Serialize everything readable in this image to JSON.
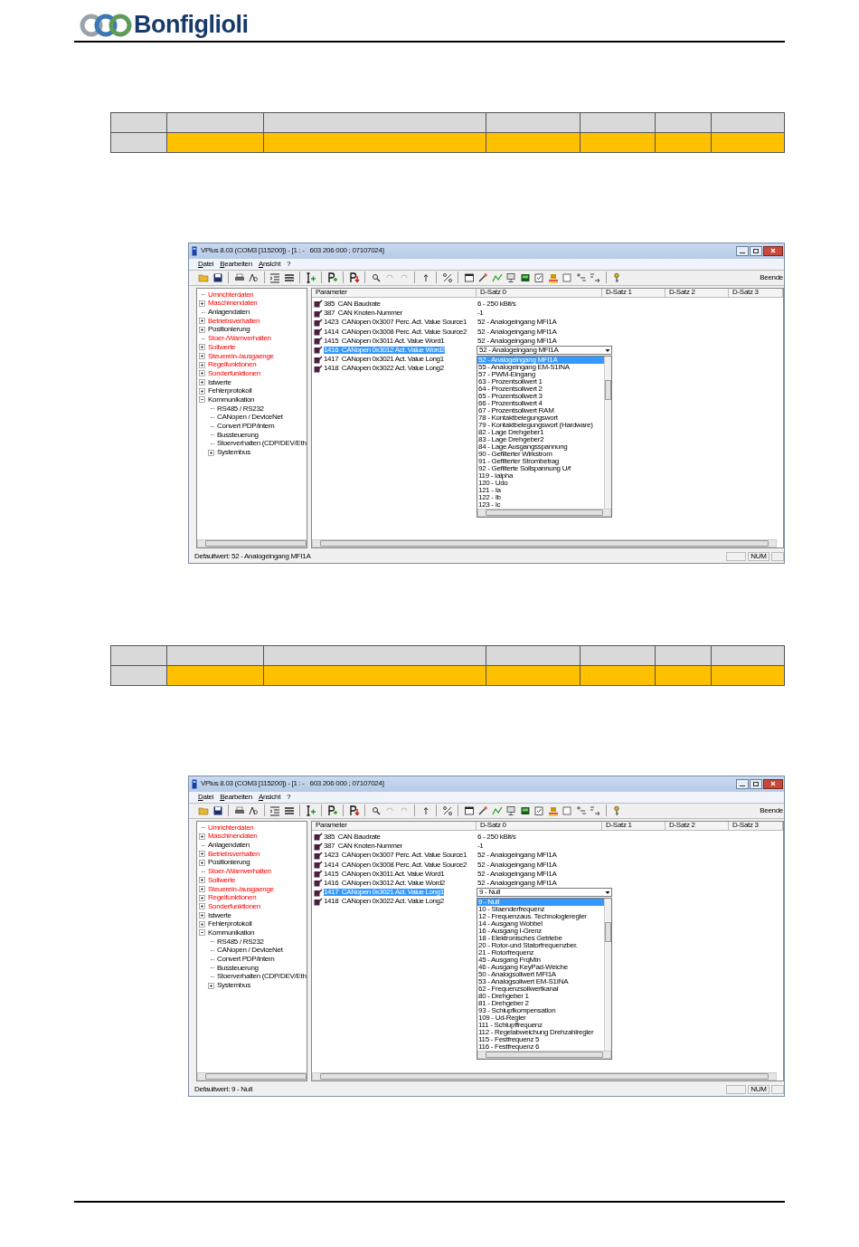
{
  "brand": "Bonfiglioli",
  "tables": [
    {
      "rows": [
        [
          {
            "color": "#d9d9d9"
          },
          {
            "color": "#d9d9d9"
          },
          {
            "color": "#d9d9d9"
          },
          {
            "color": "#d9d9d9"
          },
          {
            "color": "#d9d9d9"
          },
          {
            "color": "#d9d9d9"
          },
          {
            "color": "#d9d9d9"
          }
        ],
        [
          {
            "color": "#d9d9d9"
          },
          {
            "color": "#ffc000"
          },
          {
            "color": "#ffc000"
          },
          {
            "color": "#ffc000"
          },
          {
            "color": "#ffc000"
          },
          {
            "color": "#ffc000"
          },
          {
            "color": "#ffc000"
          }
        ]
      ]
    },
    {
      "rows": [
        [
          {
            "color": "#d9d9d9"
          },
          {
            "color": "#d9d9d9"
          },
          {
            "color": "#d9d9d9"
          },
          {
            "color": "#d9d9d9"
          },
          {
            "color": "#d9d9d9"
          },
          {
            "color": "#d9d9d9"
          },
          {
            "color": "#d9d9d9"
          }
        ],
        [
          {
            "color": "#d9d9d9"
          },
          {
            "color": "#ffc000"
          },
          {
            "color": "#ffc000"
          },
          {
            "color": "#ffc000"
          },
          {
            "color": "#ffc000"
          },
          {
            "color": "#ffc000"
          },
          {
            "color": "#ffc000"
          }
        ]
      ]
    }
  ],
  "screens": [
    {
      "title": "VPlus 8.03 (COM3 [115200]) - [1 : -   603 206 000 ; 07107024]",
      "menu": [
        "Datei",
        "Bearbeiten",
        "Ansicht",
        "?"
      ],
      "toolbar_label": "Beende",
      "tree": [
        {
          "label": "Umrichterdaten",
          "emphasized": true,
          "kind": "leaf"
        },
        {
          "label": "Maschinendaten",
          "emphasized": true,
          "kind": "branch",
          "expanded": false
        },
        {
          "label": "Anlagendaten",
          "emphasized": false,
          "kind": "leaf"
        },
        {
          "label": "Betriebsverhalten",
          "emphasized": true,
          "kind": "branch",
          "expanded": false
        },
        {
          "label": "Positionierung",
          "emphasized": false,
          "kind": "branch",
          "expanded": false
        },
        {
          "label": "Stoer-/Warnverhalten",
          "emphasized": true,
          "kind": "leaf"
        },
        {
          "label": "Sollwerte",
          "emphasized": true,
          "kind": "branch",
          "expanded": false
        },
        {
          "label": "Steuerein-/ausgaenge",
          "emphasized": true,
          "kind": "branch",
          "expanded": false
        },
        {
          "label": "Regelfunktionen",
          "emphasized": true,
          "kind": "branch",
          "expanded": false
        },
        {
          "label": "Sonderfunktionen",
          "emphasized": true,
          "kind": "branch",
          "expanded": false
        },
        {
          "label": "Istwerte",
          "emphasized": false,
          "kind": "branch",
          "expanded": false
        },
        {
          "label": "Fehlerprotokoll",
          "emphasized": false,
          "kind": "branch",
          "expanded": false
        },
        {
          "label": "Kommunikation",
          "emphasized": false,
          "kind": "branch",
          "expanded": true,
          "children": [
            {
              "label": "RS485 / RS232",
              "emphasized": false,
              "kind": "leaf"
            },
            {
              "label": "CANopen / DeviceNet",
              "emphasized": false,
              "kind": "leaf"
            },
            {
              "label": "Convert PDP/intern",
              "emphasized": false,
              "kind": "leaf"
            },
            {
              "label": "Bussteuerung",
              "emphasized": false,
              "kind": "leaf"
            },
            {
              "label": "Stoerverhalten (CDP/DEV/Eth",
              "emphasized": false,
              "kind": "leaf"
            },
            {
              "label": "Systembus",
              "emphasized": false,
              "kind": "branch",
              "expanded": false
            }
          ]
        }
      ],
      "columns": [
        "Parameter",
        "D-Satz 0",
        "D-Satz 1",
        "D-Satz 2",
        "D-Satz 3"
      ],
      "rows": [
        {
          "number": "385",
          "name": "CAN Baudrate",
          "value": "6 - 250 kBit/s",
          "selected": false
        },
        {
          "number": "387",
          "name": "CAN Knoten-Nummer",
          "value": "-1",
          "selected": false
        },
        {
          "number": "1423",
          "name": "CANopen 0x3007 Perc. Act. Value Source1",
          "value": "52 - Analogeingang MFI1A",
          "selected": false
        },
        {
          "number": "1414",
          "name": "CANopen 0x3008 Perc. Act. Value Source2",
          "value": "52 - Analogeingang MFI1A",
          "selected": false
        },
        {
          "number": "1415",
          "name": "CANopen 0x3011 Act. Value Word1",
          "value": "52 - Analogeingang MFI1A",
          "selected": false
        },
        {
          "number": "1416",
          "name": "CANopen 0x3012 Act. Value Word2",
          "selected": true,
          "dropdown": {
            "value": "52 - Analogeingang MFI1A",
            "options": [
              {
                "label": "52 - Analogeingang MFI1A",
                "selected": true
              },
              {
                "label": "55 - Analogeingang EM-S1INA",
                "selected": false
              },
              {
                "label": "57 - PWM-Eingang",
                "selected": false
              },
              {
                "label": "63 - Prozentsollwert 1",
                "selected": false
              },
              {
                "label": "64 - Prozentsollwert 2",
                "selected": false
              },
              {
                "label": "65 - Prozentsollwert 3",
                "selected": false
              },
              {
                "label": "66 - Prozentsollwert 4",
                "selected": false
              },
              {
                "label": "67 - Prozentsollwert RAM",
                "selected": false
              },
              {
                "label": "78 - Kontaktbelegungswort",
                "selected": false
              },
              {
                "label": "79 - Kontaktbelegungswort (Hardware)",
                "selected": false
              },
              {
                "label": "82 - Lage Drehgeber1",
                "selected": false
              },
              {
                "label": "83 - Lage Drehgeber2",
                "selected": false
              },
              {
                "label": "84 - Lage Ausgangsspannung",
                "selected": false
              },
              {
                "label": "90 - Gefilterter Wirkstrom",
                "selected": false
              },
              {
                "label": "91 - Gefilterter Strombetrag",
                "selected": false
              },
              {
                "label": "92 - Gefilterte Sollspannung U/f",
                "selected": false
              },
              {
                "label": "119 - Ialpha",
                "selected": false
              },
              {
                "label": "120 - Udo",
                "selected": false
              },
              {
                "label": "121 - Ia",
                "selected": false
              },
              {
                "label": "122 - Ib",
                "selected": false
              },
              {
                "label": "123 - Ic",
                "selected": false
              }
            ]
          }
        },
        {
          "number": "1417",
          "name": "CANopen 0x3021 Act. Value Long1",
          "selected": false
        },
        {
          "number": "1418",
          "name": "CANopen 0x3022 Act. Value Long2",
          "selected": false
        }
      ],
      "status": "Defaultwert: 52 - Analogeingang MFI1A",
      "indicator": "NUM"
    },
    {
      "title": "VPlus 8.03 (COM3 [115200]) - [1 : -   603 206 000 ; 07107024]",
      "menu": [
        "Datei",
        "Bearbeiten",
        "Ansicht",
        "?"
      ],
      "toolbar_label": "Beende",
      "tree": [
        {
          "label": "Umrichterdaten",
          "emphasized": true,
          "kind": "leaf"
        },
        {
          "label": "Maschinendaten",
          "emphasized": true,
          "kind": "branch",
          "expanded": false
        },
        {
          "label": "Anlagendaten",
          "emphasized": false,
          "kind": "leaf"
        },
        {
          "label": "Betriebsverhalten",
          "emphasized": true,
          "kind": "branch",
          "expanded": false
        },
        {
          "label": "Positionierung",
          "emphasized": false,
          "kind": "branch",
          "expanded": false
        },
        {
          "label": "Stoer-/Warnverhalten",
          "emphasized": true,
          "kind": "leaf"
        },
        {
          "label": "Sollwerte",
          "emphasized": true,
          "kind": "branch",
          "expanded": false
        },
        {
          "label": "Steuerein-/ausgaenge",
          "emphasized": true,
          "kind": "branch",
          "expanded": false
        },
        {
          "label": "Regelfunktionen",
          "emphasized": true,
          "kind": "branch",
          "expanded": false
        },
        {
          "label": "Sonderfunktionen",
          "emphasized": true,
          "kind": "branch",
          "expanded": false
        },
        {
          "label": "Istwerte",
          "emphasized": false,
          "kind": "branch",
          "expanded": false
        },
        {
          "label": "Fehlerprotokoll",
          "emphasized": false,
          "kind": "branch",
          "expanded": false
        },
        {
          "label": "Kommunikation",
          "emphasized": false,
          "kind": "branch",
          "expanded": true,
          "children": [
            {
              "label": "RS485 / RS232",
              "emphasized": false,
              "kind": "leaf"
            },
            {
              "label": "CANopen / DeviceNet",
              "emphasized": false,
              "kind": "leaf"
            },
            {
              "label": "Convert PDP/intern",
              "emphasized": false,
              "kind": "leaf"
            },
            {
              "label": "Bussteuerung",
              "emphasized": false,
              "kind": "leaf"
            },
            {
              "label": "Stoerverhalten (CDP/DEV/Eth",
              "emphasized": false,
              "kind": "leaf"
            },
            {
              "label": "Systembus",
              "emphasized": false,
              "kind": "branch",
              "expanded": false
            }
          ]
        }
      ],
      "columns": [
        "Parameter",
        "D-Satz 0",
        "D-Satz 1",
        "D-Satz 2",
        "D-Satz 3"
      ],
      "rows": [
        {
          "number": "385",
          "name": "CAN Baudrate",
          "value": "6 - 250 kBit/s",
          "selected": false
        },
        {
          "number": "387",
          "name": "CAN Knoten-Nummer",
          "value": "-1",
          "selected": false
        },
        {
          "number": "1423",
          "name": "CANopen 0x3007 Perc. Act. Value Source1",
          "value": "52 - Analogeingang MFI1A",
          "selected": false
        },
        {
          "number": "1414",
          "name": "CANopen 0x3008 Perc. Act. Value Source2",
          "value": "52 - Analogeingang MFI1A",
          "selected": false
        },
        {
          "number": "1415",
          "name": "CANopen 0x3011 Act. Value Word1",
          "value": "52 - Analogeingang MFI1A",
          "selected": false
        },
        {
          "number": "1416",
          "name": "CANopen 0x3012 Act. Value Word2",
          "value": "52 - Analogeingang MFI1A",
          "selected": false
        },
        {
          "number": "1417",
          "name": "CANopen 0x3021 Act. Value Long1",
          "selected": true,
          "dropdown": {
            "value": "9 - Null",
            "options": [
              {
                "label": "9 - Null",
                "selected": true
              },
              {
                "label": "10 - Staenderfrequenz",
                "selected": false
              },
              {
                "label": "12 - Frequenzaus. Technologieregler",
                "selected": false
              },
              {
                "label": "14 - Ausgang Wobbel",
                "selected": false
              },
              {
                "label": "16 - Ausgang I-Grenz",
                "selected": false
              },
              {
                "label": "18 - Elektronisches Getriebe",
                "selected": false
              },
              {
                "label": "20 - Rotor-und Statorfrequenzber.",
                "selected": false
              },
              {
                "label": "21 - Rotorfrequenz",
                "selected": false
              },
              {
                "label": "45 - Ausgang FrqMin",
                "selected": false
              },
              {
                "label": "46 - Ausgang KeyPad-Weiche",
                "selected": false
              },
              {
                "label": "50 - Analogsollwert MFI1A",
                "selected": false
              },
              {
                "label": "53 - Analogsollwert EM-S1INA",
                "selected": false
              },
              {
                "label": "62 - Frequenzsollwertkanal",
                "selected": false
              },
              {
                "label": "80 - Drehgeber 1",
                "selected": false
              },
              {
                "label": "81 - Drehgeber 2",
                "selected": false
              },
              {
                "label": "93 - Schlupfkompensation",
                "selected": false
              },
              {
                "label": "109 - Ud-Regler",
                "selected": false
              },
              {
                "label": "111 - Schlupffrequenz",
                "selected": false
              },
              {
                "label": "112 - Regelabweichung Drehzahlregler",
                "selected": false
              },
              {
                "label": "115 - Festfrequenz 5",
                "selected": false
              },
              {
                "label": "116 - Festfrequenz 6",
                "selected": false
              }
            ]
          }
        },
        {
          "number": "1418",
          "name": "CANopen 0x3022 Act. Value Long2",
          "selected": false
        }
      ],
      "status": "Defaultwert: 9 - Null",
      "indicator": "NUM"
    }
  ]
}
